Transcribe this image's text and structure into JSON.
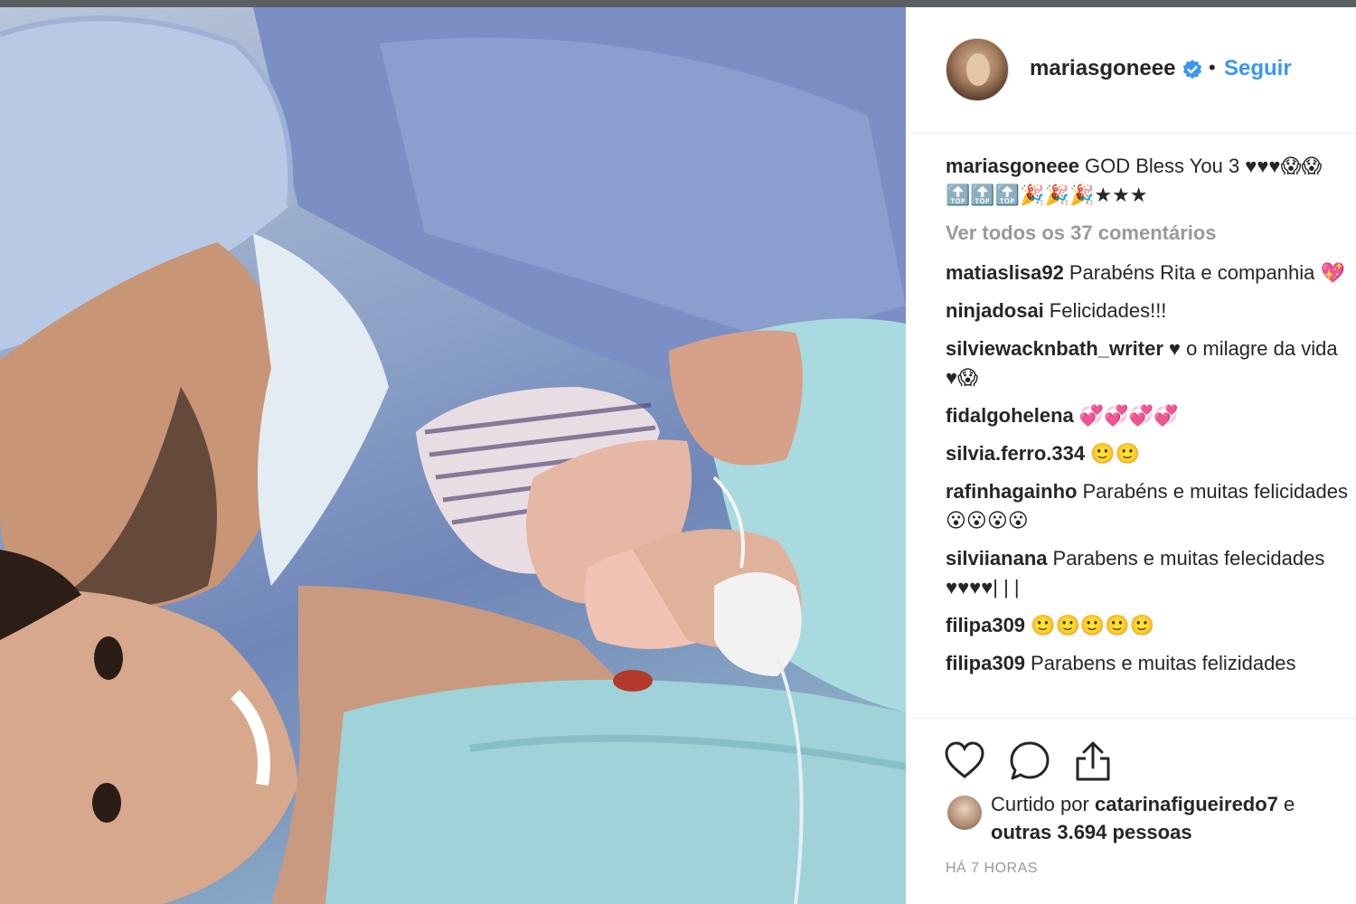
{
  "post": {
    "username": "mariasgoneee",
    "follow_label": "Seguir",
    "separator": "•",
    "caption": {
      "username": "mariasgoneee",
      "text": "GOD Bless You 3 ♥♥♥😱😱 🔝🔝🔝🎉🎉🎉★★★"
    },
    "view_all_comments": "Ver todos os 37 comentários",
    "comments": [
      {
        "username": "matiaslisa92",
        "text": "Parabéns Rita e companhia 💖"
      },
      {
        "username": "ninjadosai",
        "text": "Felicidades!!!"
      },
      {
        "username": "silviewacknbath_writer",
        "text": "♥ o milagre da vida ♥😱"
      },
      {
        "username": "fidalgohelena",
        "text": "💞💞💞💞"
      },
      {
        "username": "silvia.ferro.334",
        "text": "🙂🙂"
      },
      {
        "username": "rafinhagainho",
        "text": "Parabéns e muitas felicidades😮😮😮😮"
      },
      {
        "username": "silviianana",
        "text": "Parabens e muitas felecidades ♥♥♥♥| | |"
      },
      {
        "username": "filipa309",
        "text": "🙂🙂🙂🙂🙂"
      },
      {
        "username": "filipa309",
        "text": "Parabens e muitas felizidades"
      }
    ],
    "likes": {
      "prefix": "Curtido por",
      "liker": "catarinafigueiredo7",
      "joiner": "e",
      "others": "outras 3.694 pessoas"
    },
    "timestamp": "HÁ 7 HORAS"
  },
  "icons": {
    "verified": "verified-badge-icon",
    "like": "heart-icon",
    "comment": "comment-bubble-icon",
    "share": "share-upload-icon"
  },
  "colors": {
    "link": "#3897f0",
    "muted": "#999999",
    "text": "#262626",
    "verified": "#3897f0"
  }
}
